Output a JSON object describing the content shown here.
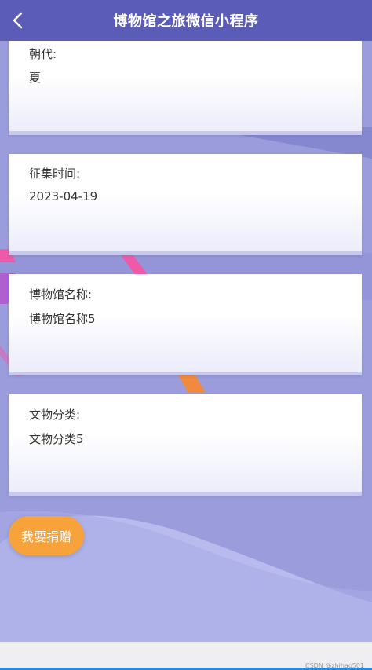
{
  "header": {
    "title": "博物馆之旅微信小程序"
  },
  "cards": [
    {
      "label": "朝代:",
      "value": "夏"
    },
    {
      "label": "征集时间:",
      "value": "2023-04-19"
    },
    {
      "label": "博物馆名称:",
      "value": "博物馆名称5"
    },
    {
      "label": "文物分类:",
      "value": "文物分类5"
    }
  ],
  "donate_button": {
    "label": "我要捐赠"
  },
  "watermark": "CSDN @zhihao501",
  "colors": {
    "header": "#5b5bb8",
    "background": "#9a9cdb",
    "donate": "#f7a23a",
    "card": "#ffffff"
  }
}
